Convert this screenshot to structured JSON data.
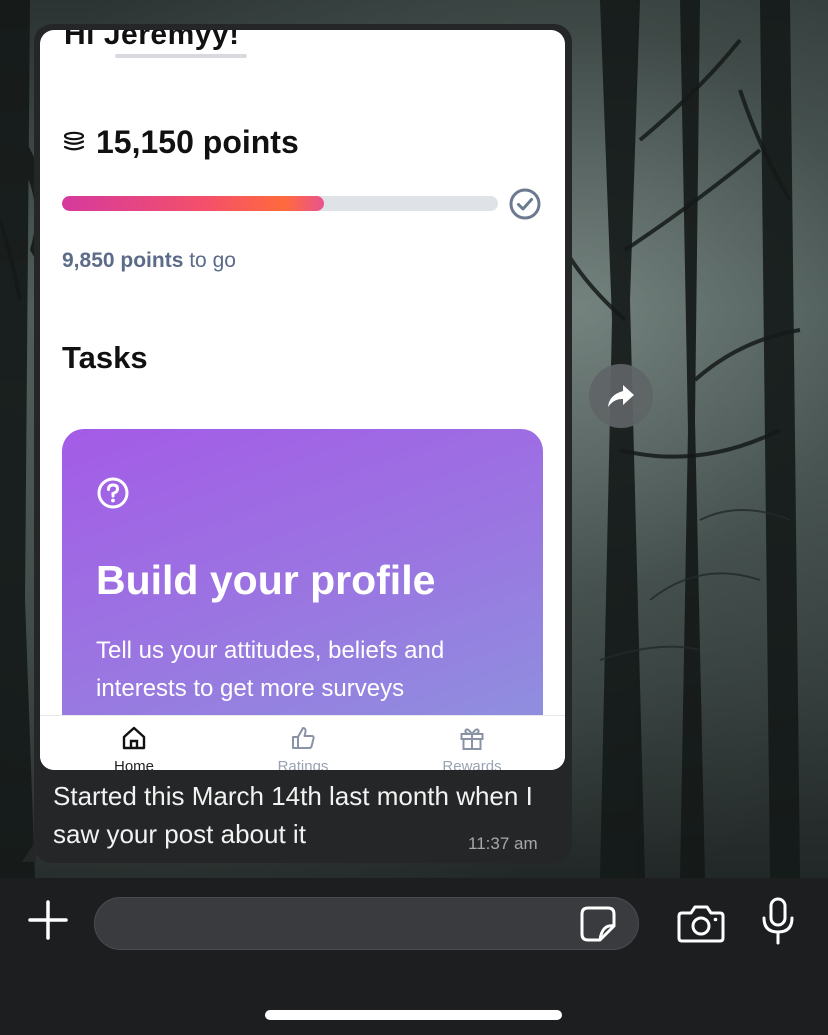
{
  "screenshot": {
    "greeting": "Hi Jeremyy!",
    "points_total": "15,150 points",
    "progress": 0.6,
    "points_to_go_value": "9,850 points",
    "points_to_go_suffix": " to go",
    "tasks_heading": "Tasks",
    "task_card": {
      "title": "Build your profile",
      "description": "Tell us your attitudes, beliefs and interests to get more surveys"
    },
    "tabs": [
      {
        "label": "Home",
        "icon": "home-icon",
        "active": true
      },
      {
        "label": "Ratings",
        "icon": "thumbs-up-icon",
        "active": false
      },
      {
        "label": "Rewards",
        "icon": "gift-icon",
        "active": false
      }
    ]
  },
  "message": {
    "caption": "Started this March 14th last month when I saw your post about it",
    "time": "11:37 am"
  },
  "colors": {
    "bubble": "#242627",
    "progress_fill_start": "#d53a9d",
    "progress_fill_end": "#ff6a3d",
    "task_card_start": "#a45be7",
    "task_card_end": "#8c95de"
  },
  "icons": [
    "coins-icon",
    "check-circle-icon",
    "question-icon",
    "forward-icon",
    "plus-icon",
    "sticker-icon",
    "camera-icon",
    "mic-icon"
  ]
}
